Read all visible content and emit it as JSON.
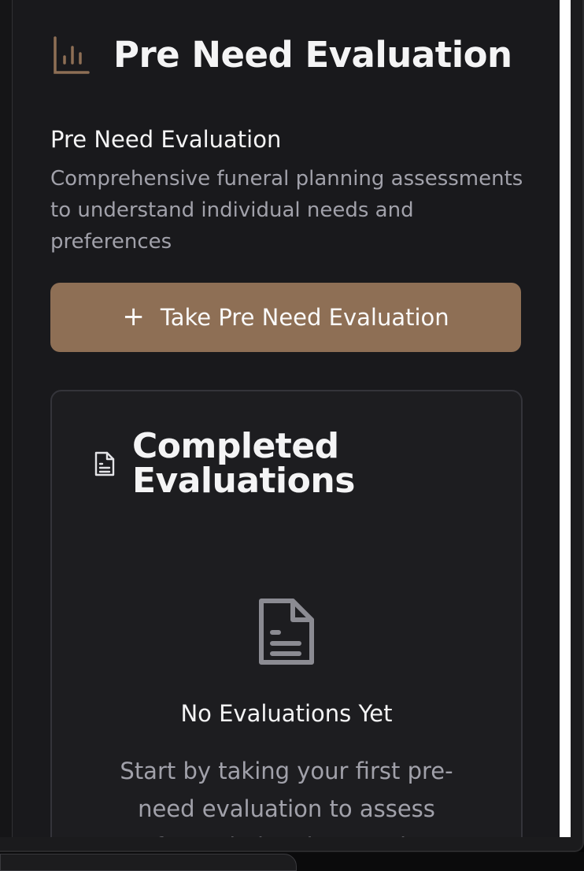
{
  "header": {
    "title": "Pre Need Evaluation",
    "icon": "bar-chart-icon"
  },
  "intro": {
    "title": "Pre Need Evaluation",
    "description": "Comprehensive funeral planning assessments to understand individual needs and preferences"
  },
  "actions": {
    "take_evaluation_label": "Take Pre Need Evaluation",
    "take_evaluation_icon": "plus-icon"
  },
  "completed": {
    "title": "Completed Evaluations",
    "icon": "document-icon",
    "empty_title": "No Evaluations Yet",
    "empty_description": "Start by taking your first pre-need evaluation to assess funeral planning needs"
  },
  "colors": {
    "accent": "#8e6f55",
    "background": "#19191c",
    "card_background": "#1d1d20",
    "text_primary": "#f4f4f5",
    "text_secondary": "#a1a1aa"
  }
}
